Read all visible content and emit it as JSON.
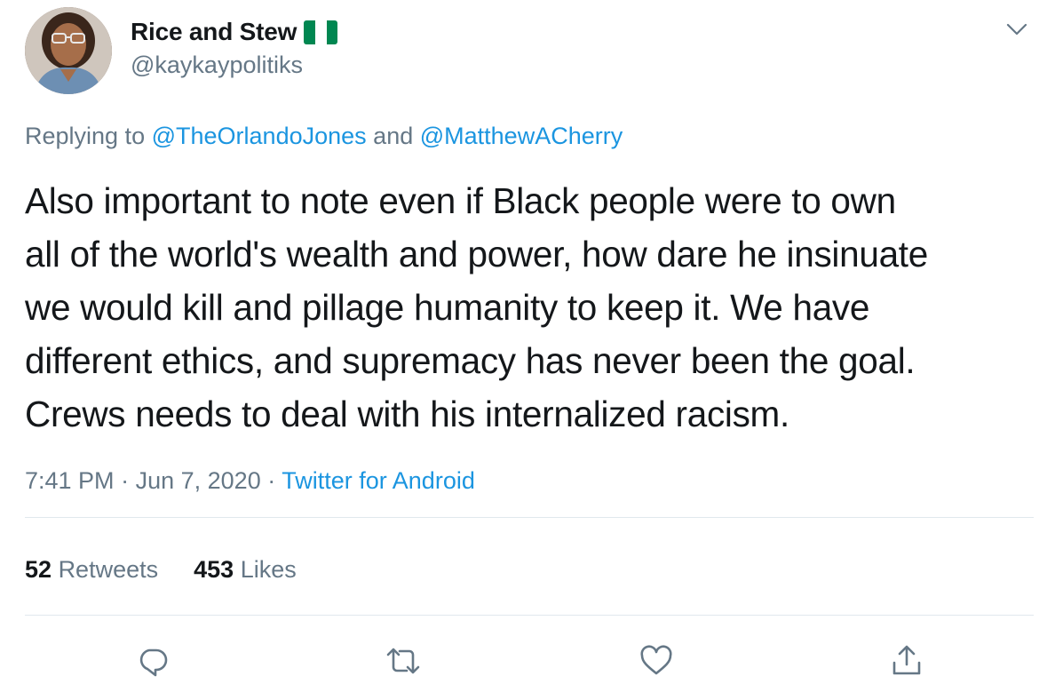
{
  "user": {
    "display_name": "Rice and Stew",
    "flag_icon": "nigeria-flag-icon",
    "flag_colors": [
      "#008751",
      "#ffffff",
      "#008751"
    ],
    "handle": "@kaykaypolitiks"
  },
  "reply": {
    "prefix": "Replying to",
    "mention_1": "@TheOrlandoJones",
    "joiner": "and",
    "mention_2": "@MatthewACherry"
  },
  "tweet": {
    "text": "Also important to note even if Black people were to own\nall of the world's wealth and power, how dare he insinuate\nwe would kill and pillage humanity to keep it. We have\ndifferent ethics, and supremacy has never been the goal.\nCrews needs to deal with his internalized racism."
  },
  "meta": {
    "time": "7:41 PM",
    "separator": "·",
    "date": "Jun 7, 2020",
    "source": "Twitter for Android"
  },
  "stats": {
    "retweets_count": "52",
    "retweets_label": "Retweets",
    "likes_count": "453",
    "likes_label": "Likes"
  },
  "actions": {
    "reply_icon": "reply-icon",
    "retweet_icon": "retweet-icon",
    "like_icon": "heart-icon",
    "share_icon": "share-icon"
  },
  "colors": {
    "link": "#1b95e0",
    "secondary_text": "#657786",
    "primary_text": "#14171a",
    "divider": "#e1e8ed"
  }
}
